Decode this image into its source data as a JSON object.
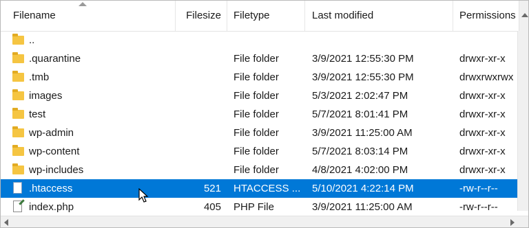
{
  "headers": {
    "filename": "Filename",
    "filesize": "Filesize",
    "filetype": "Filetype",
    "last_modified": "Last modified",
    "permissions": "Permissions"
  },
  "files": [
    {
      "name": "..",
      "size": "",
      "type": "",
      "modified": "",
      "perms": "",
      "icon": "folder-icon"
    },
    {
      "name": ".quarantine",
      "size": "",
      "type": "File folder",
      "modified": "3/9/2021 12:55:30 PM",
      "perms": "drwxr-xr-x",
      "icon": "folder-icon"
    },
    {
      "name": ".tmb",
      "size": "",
      "type": "File folder",
      "modified": "3/9/2021 12:55:30 PM",
      "perms": "drwxrwxrwx",
      "icon": "folder-icon"
    },
    {
      "name": "images",
      "size": "",
      "type": "File folder",
      "modified": "5/3/2021 2:02:47 PM",
      "perms": "drwxr-xr-x",
      "icon": "folder-icon"
    },
    {
      "name": "test",
      "size": "",
      "type": "File folder",
      "modified": "5/7/2021 8:01:41 PM",
      "perms": "drwxr-xr-x",
      "icon": "folder-icon"
    },
    {
      "name": "wp-admin",
      "size": "",
      "type": "File folder",
      "modified": "3/9/2021 11:25:00 AM",
      "perms": "drwxr-xr-x",
      "icon": "folder-icon"
    },
    {
      "name": "wp-content",
      "size": "",
      "type": "File folder",
      "modified": "5/7/2021 8:03:14 PM",
      "perms": "drwxr-xr-x",
      "icon": "folder-icon"
    },
    {
      "name": "wp-includes",
      "size": "",
      "type": "File folder",
      "modified": "4/8/2021 4:02:00 PM",
      "perms": "drwxr-xr-x",
      "icon": "folder-icon"
    },
    {
      "name": ".htaccess",
      "size": "521",
      "type": "HTACCESS ...",
      "modified": "5/10/2021 4:22:14 PM",
      "perms": "-rw-r--r--",
      "icon": "file-icon",
      "selected": true
    },
    {
      "name": "index.php",
      "size": "405",
      "type": "PHP File",
      "modified": "3/9/2021 11:25:00 AM",
      "perms": "-rw-r--r--",
      "icon": "php-file-icon"
    }
  ],
  "colors": {
    "selection": "#0078d7",
    "folder": "#f5c542"
  }
}
